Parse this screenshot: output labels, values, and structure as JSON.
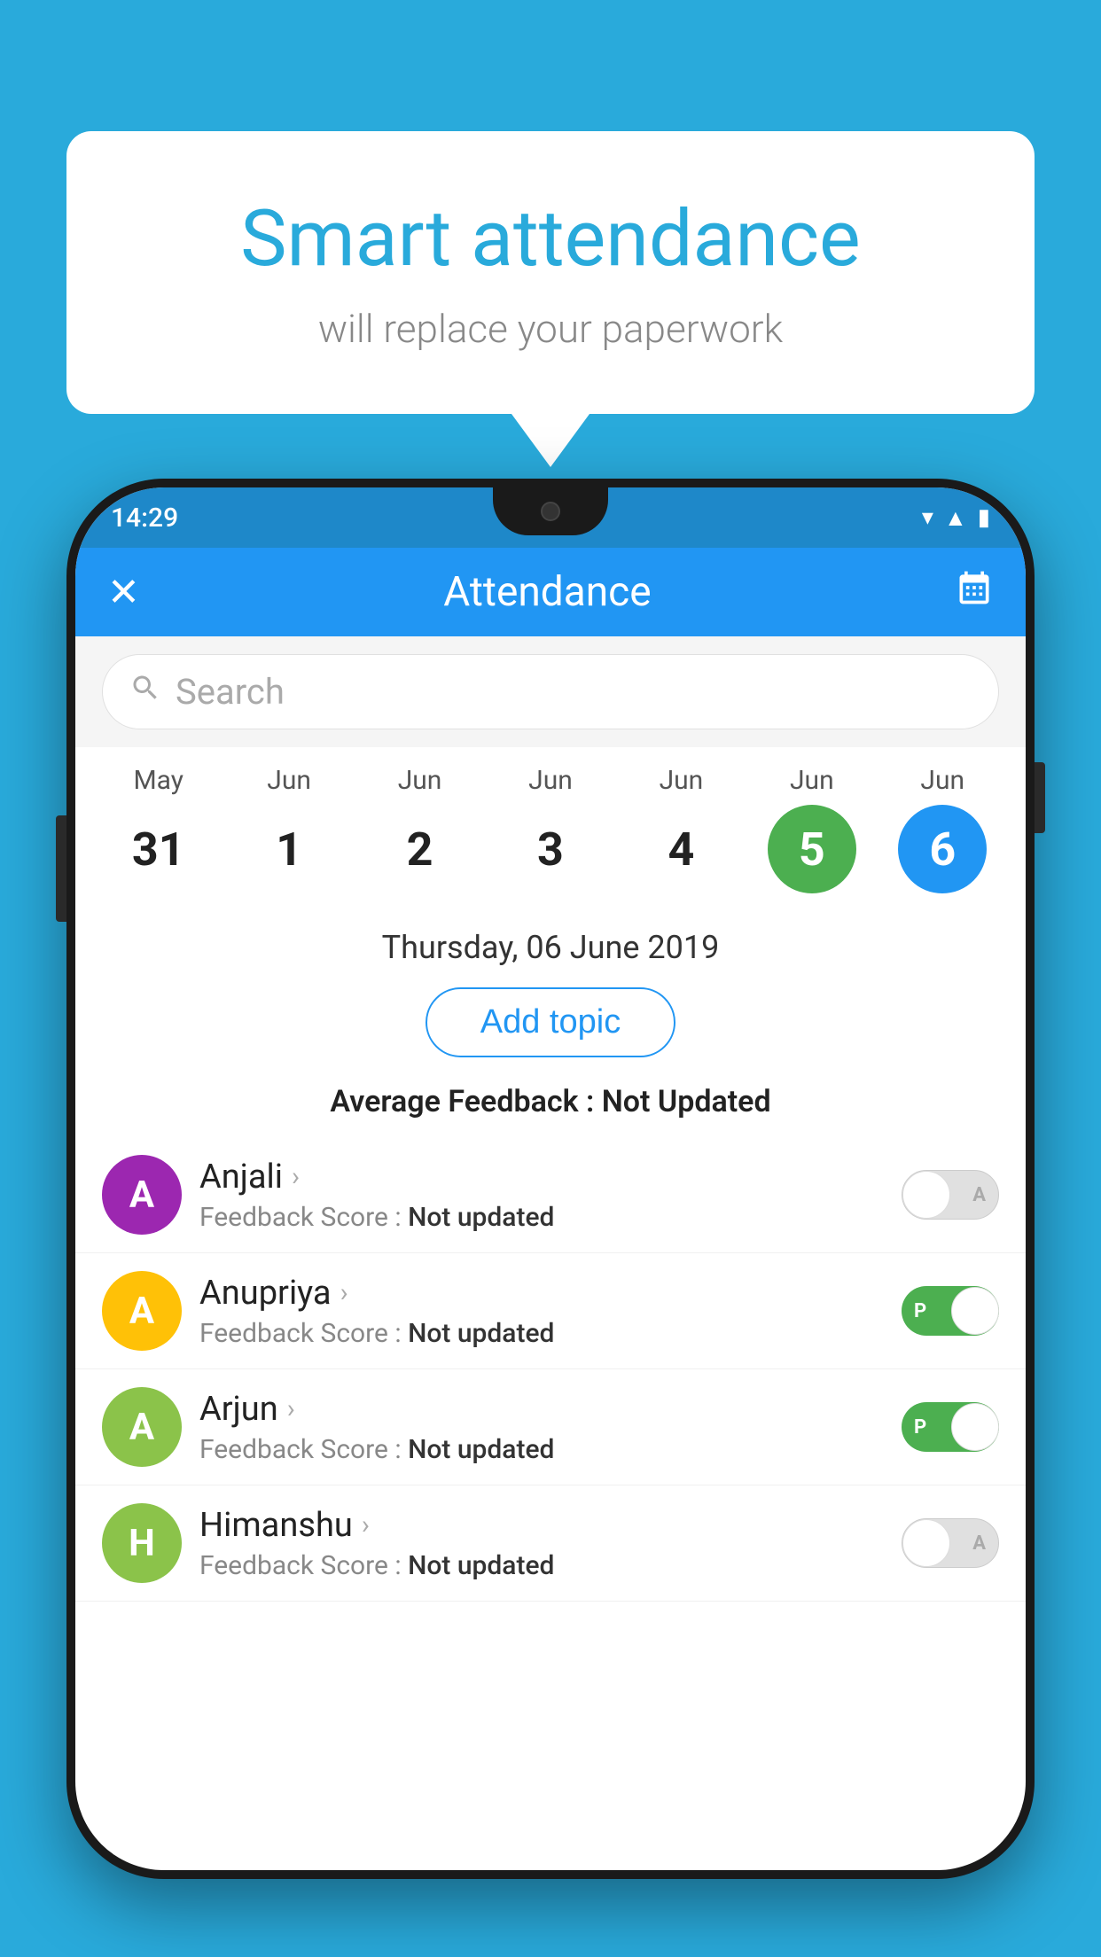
{
  "background_color": "#29AADB",
  "speech_bubble": {
    "title": "Smart attendance",
    "subtitle": "will replace your paperwork"
  },
  "status_bar": {
    "time": "14:29",
    "icons": [
      "wifi",
      "signal",
      "battery"
    ]
  },
  "app_bar": {
    "title": "Attendance",
    "close_label": "✕",
    "calendar_label": "📅"
  },
  "search": {
    "placeholder": "Search"
  },
  "calendar": {
    "days": [
      {
        "month": "May",
        "day": "31",
        "state": "normal"
      },
      {
        "month": "Jun",
        "day": "1",
        "state": "normal"
      },
      {
        "month": "Jun",
        "day": "2",
        "state": "normal"
      },
      {
        "month": "Jun",
        "day": "3",
        "state": "normal"
      },
      {
        "month": "Jun",
        "day": "4",
        "state": "normal"
      },
      {
        "month": "Jun",
        "day": "5",
        "state": "today"
      },
      {
        "month": "Jun",
        "day": "6",
        "state": "selected"
      }
    ]
  },
  "selected_date": "Thursday, 06 June 2019",
  "add_topic_label": "Add topic",
  "average_feedback": {
    "label": "Average Feedback : ",
    "value": "Not Updated"
  },
  "students": [
    {
      "name": "Anjali",
      "avatar_letter": "A",
      "avatar_color": "#9C27B0",
      "feedback_label": "Feedback Score : ",
      "feedback_value": "Not updated",
      "toggle_state": "off",
      "toggle_letter": "A"
    },
    {
      "name": "Anupriya",
      "avatar_letter": "A",
      "avatar_color": "#FFC107",
      "feedback_label": "Feedback Score : ",
      "feedback_value": "Not updated",
      "toggle_state": "on",
      "toggle_letter": "P"
    },
    {
      "name": "Arjun",
      "avatar_letter": "A",
      "avatar_color": "#8BC34A",
      "feedback_label": "Feedback Score : ",
      "feedback_value": "Not updated",
      "toggle_state": "on",
      "toggle_letter": "P"
    },
    {
      "name": "Himanshu",
      "avatar_letter": "H",
      "avatar_color": "#8BC34A",
      "feedback_label": "Feedback Score : ",
      "feedback_value": "Not updated",
      "toggle_state": "off",
      "toggle_letter": "A"
    }
  ]
}
